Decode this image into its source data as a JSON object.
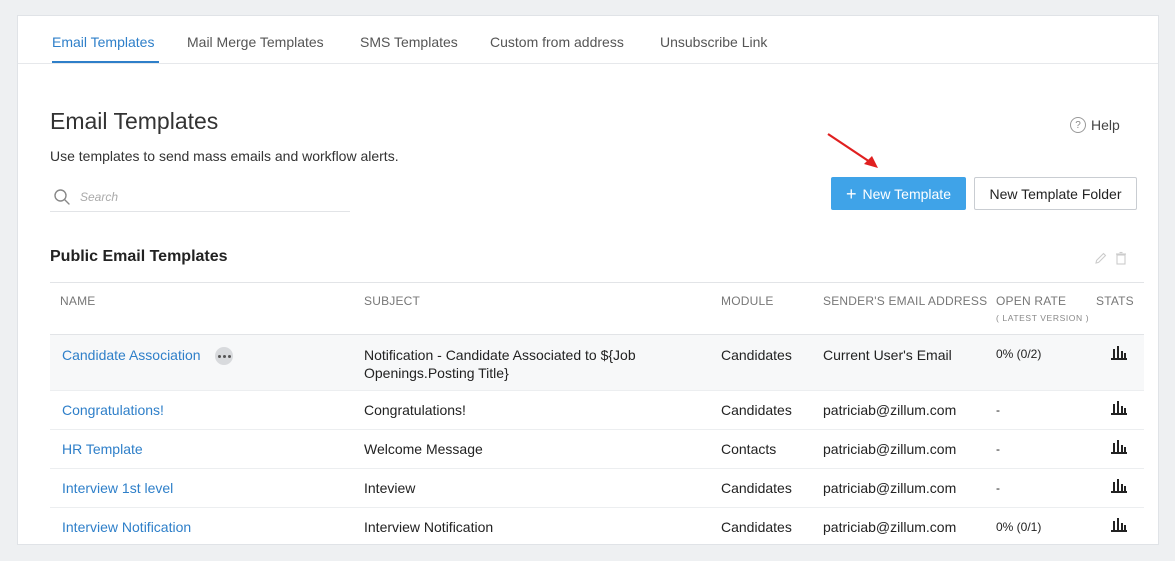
{
  "tabs": [
    {
      "label": "Email Templates"
    },
    {
      "label": "Mail Merge Templates"
    },
    {
      "label": "SMS Templates"
    },
    {
      "label": "Custom from address"
    },
    {
      "label": "Unsubscribe Link"
    }
  ],
  "header": {
    "title": "Email Templates",
    "description": "Use templates to send mass emails and workflow alerts.",
    "help_label": "Help",
    "help_icon_glyph": "?"
  },
  "search": {
    "placeholder": "Search"
  },
  "actions": {
    "new_template_label": "New Template",
    "new_template_plus": "+",
    "new_folder_label": "New Template Folder"
  },
  "section": {
    "title": "Public Email Templates"
  },
  "table": {
    "columns": {
      "name": "NAME",
      "subject": "SUBJECT",
      "module": "MODULE",
      "sender": "SENDER'S EMAIL ADDRESS",
      "open_rate": "OPEN RATE",
      "open_rate_sub": "( LATEST VERSION )",
      "stats": "STATS"
    },
    "rows": [
      {
        "name": "Candidate Association",
        "subject": "Notification - Candidate Associated to ${Job Openings.Posting Title}",
        "module": "Candidates",
        "sender": "Current User's Email",
        "open_rate": "0% (0/2)"
      },
      {
        "name": "Congratulations!",
        "subject": "Congratulations!",
        "module": "Candidates",
        "sender": "patriciab@zillum.com",
        "open_rate": "-"
      },
      {
        "name": "HR Template",
        "subject": "Welcome Message",
        "module": "Contacts",
        "sender": "patriciab@zillum.com",
        "open_rate": "-"
      },
      {
        "name": "Interview 1st level",
        "subject": "Inteview",
        "module": "Candidates",
        "sender": "patriciab@zillum.com",
        "open_rate": "-"
      },
      {
        "name": "Interview Notification",
        "subject": "Interview Notification",
        "module": "Candidates",
        "sender": "patriciab@zillum.com",
        "open_rate": "0% (0/1)"
      }
    ]
  },
  "colors": {
    "accent": "#2e7fc9",
    "primary_button": "#3fa3e8",
    "annotation_arrow": "#e02020"
  },
  "icons": {
    "search": "search-icon",
    "help": "help-icon",
    "edit": "pencil-icon",
    "delete": "trash-icon",
    "stats": "bar-chart-icon",
    "more": "more-options-icon",
    "annotation": "red-arrow-icon"
  }
}
